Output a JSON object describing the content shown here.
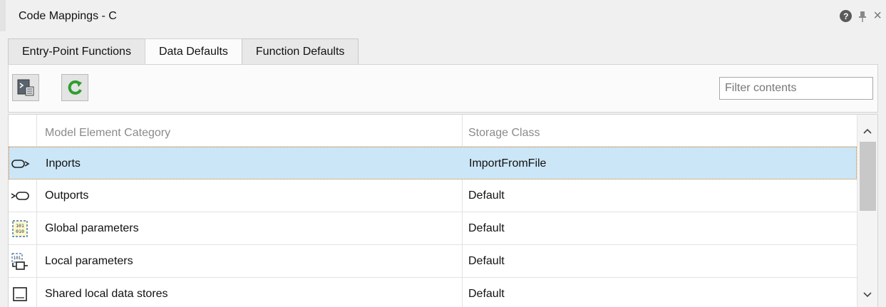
{
  "panel": {
    "title": "Code Mappings - C"
  },
  "title_icons": {
    "help": "?",
    "pin": "⊥",
    "close": "×"
  },
  "tabs": [
    {
      "label": "Entry-Point Functions"
    },
    {
      "label": "Data Defaults",
      "active": true
    },
    {
      "label": "Function Defaults"
    }
  ],
  "toolbar": {
    "buttons": [
      {
        "icon": "configure-icon"
      },
      {
        "icon": "refresh-icon"
      }
    ],
    "filter_placeholder": "Filter contents"
  },
  "table": {
    "columns": [
      "Model Element Category",
      "Storage Class"
    ],
    "rows": [
      {
        "icon": "inport-icon",
        "category": "Inports",
        "storage_class": "ImportFromFile",
        "selected": true
      },
      {
        "icon": "outport-icon",
        "category": "Outports",
        "storage_class": "Default"
      },
      {
        "icon": "global-parameter-icon",
        "category": "Global parameters",
        "storage_class": "Default"
      },
      {
        "icon": "local-parameter-icon",
        "category": "Local parameters",
        "storage_class": "Default"
      },
      {
        "icon": "data-store-icon",
        "category": "Shared local data stores",
        "storage_class": "Default"
      }
    ]
  },
  "colors": {
    "selection": "#cbe6f7",
    "selection_border": "#e08a2c",
    "refresh": "#2f9e2f"
  }
}
